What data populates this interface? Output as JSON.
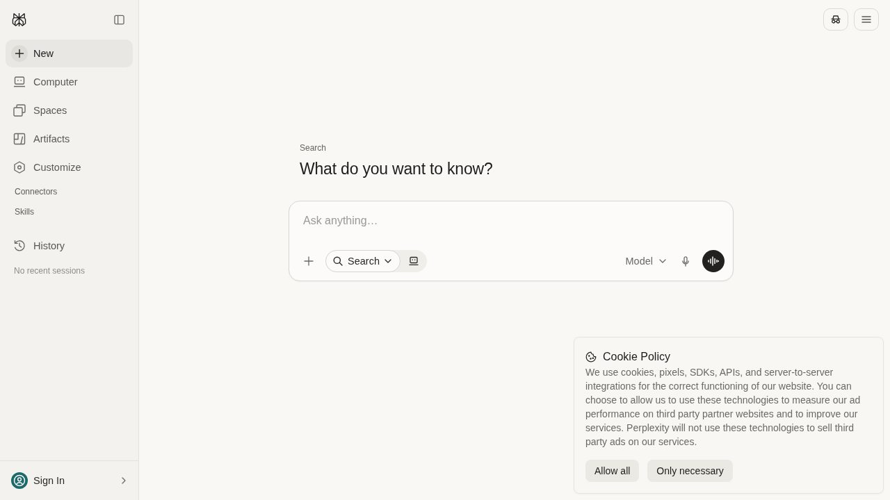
{
  "sidebar": {
    "nav_items": [
      {
        "label": "New",
        "selected": true
      },
      {
        "label": "Computer",
        "selected": false
      },
      {
        "label": "Spaces",
        "selected": false
      },
      {
        "label": "Artifacts",
        "selected": false
      },
      {
        "label": "Customize",
        "selected": false
      }
    ],
    "sub_links": [
      "Connectors",
      "Skills"
    ],
    "history": {
      "label": "History",
      "empty_message": "No recent sessions"
    },
    "account": {
      "label": "Sign In"
    }
  },
  "main": {
    "eyebrow": "Search",
    "title": "What do you want to know?",
    "composer": {
      "placeholder": "Ask anything…",
      "modes": [
        {
          "label": "Search",
          "selected": true
        },
        {
          "selected": false
        }
      ],
      "model_label": "Model"
    }
  },
  "cookie_banner": {
    "title": "Cookie Policy",
    "body": "We use cookies, pixels, SDKs, APIs, and server-to-server integrations for the correct functioning of our website. You can choose to allow us to use these technologies to measure our ad performance on third party partner websites and to improve our services. Perplexity will not use these technologies to sell third party ads on our services.",
    "buttons": [
      "Allow all",
      "Only necessary"
    ]
  }
}
